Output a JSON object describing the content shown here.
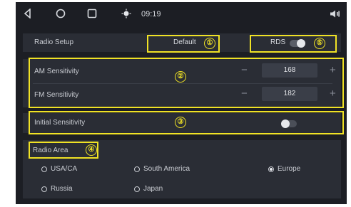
{
  "status_bar": {
    "time": "09:19",
    "icons": [
      "back-icon",
      "home-icon",
      "recents-icon",
      "brightness-icon",
      "volume-icon"
    ]
  },
  "radio_setup": {
    "label": "Radio Setup",
    "default_button": "Default",
    "rds_label": "RDS",
    "rds_toggle_on": true
  },
  "sensitivity": {
    "am": {
      "label": "AM Sensitivity",
      "value": "168",
      "minus": "−",
      "plus": "+"
    },
    "fm": {
      "label": "FM Sensitivity",
      "value": "182",
      "minus": "−",
      "plus": "+"
    }
  },
  "initial_sensitivity": {
    "label": "Initial Sensitivity",
    "toggle_on": false
  },
  "radio_area": {
    "label": "Radio Area",
    "options": [
      "USA/CA",
      "South America",
      "Europe",
      "Russia",
      "Japan"
    ],
    "selected": "Europe"
  },
  "annotations": [
    "①",
    "②",
    "③",
    "④",
    "⑤"
  ],
  "colors": {
    "annotation": "#f0e225",
    "background": "#1c1e24",
    "panel": "#2a2d35"
  }
}
